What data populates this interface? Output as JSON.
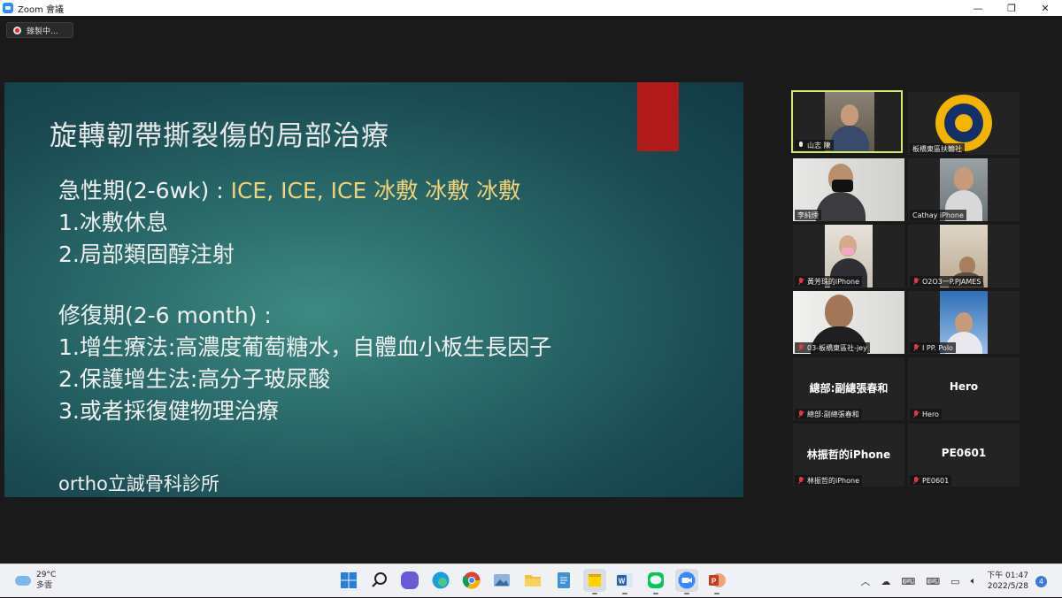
{
  "window": {
    "title": "Zoom 會議",
    "minimize": "—",
    "restore": "❐",
    "close": "✕"
  },
  "recording": {
    "label": "錄製中..."
  },
  "slide": {
    "title": "旋轉韌帶撕裂傷的局部治療",
    "acute_prefix": "急性期(2-6wk) : ",
    "acute_accent": "ICE, ICE, ICE 冰敷 冰敷 冰敷",
    "acute_items": [
      "1.冰敷休息",
      "2.局部類固醇注射"
    ],
    "repair_heading": "修復期(2-6 month) :",
    "repair_items": [
      "1.增生療法:高濃度葡萄糖水，自體血小板生長因子",
      "2.保護增生法:高分子玻尿酸",
      "3.或者採復健物理治療"
    ],
    "clinic": "ortho立誠骨科診所",
    "accent_color": "#f3d37a",
    "tab_color": "#b01a1a"
  },
  "participants": [
    {
      "name": "山志 陳",
      "muted": false,
      "active": true,
      "kind": "video"
    },
    {
      "name": "板橋東區扶輪社",
      "muted": false,
      "active": false,
      "kind": "logo"
    },
    {
      "name": "李純煙",
      "muted": false,
      "active": false,
      "kind": "video"
    },
    {
      "name": "Cathay iPhone",
      "muted": false,
      "active": false,
      "kind": "video"
    },
    {
      "name": "黃芳珠的iPhone",
      "muted": true,
      "active": false,
      "kind": "video"
    },
    {
      "name": "O2O3一P.PJAMES",
      "muted": true,
      "active": false,
      "kind": "video"
    },
    {
      "name": "03-板橋東區社-jey",
      "muted": true,
      "active": false,
      "kind": "video"
    },
    {
      "name": "I PP.  Polo",
      "muted": true,
      "active": false,
      "kind": "video"
    },
    {
      "name": "總部:副總張春和",
      "display": "總部:副總張春和",
      "muted": true,
      "active": false,
      "kind": "text"
    },
    {
      "name": "Hero",
      "display": "Hero",
      "muted": true,
      "active": false,
      "kind": "text"
    },
    {
      "name": "林振哲的iPhone",
      "display": "林振哲的iPhone",
      "muted": true,
      "active": false,
      "kind": "text"
    },
    {
      "name": "PE0601",
      "display": "PE0601",
      "muted": true,
      "active": false,
      "kind": "text"
    }
  ],
  "taskbar": {
    "weather": {
      "temp": "29°C",
      "condition": "多雲",
      "icon": "cloud-icon"
    },
    "apps": [
      {
        "name": "start-icon",
        "running": false
      },
      {
        "name": "search-icon",
        "running": false
      },
      {
        "name": "chat-icon",
        "running": false
      },
      {
        "name": "edge-icon",
        "running": false
      },
      {
        "name": "chrome-icon",
        "running": false
      },
      {
        "name": "photos-icon",
        "running": false
      },
      {
        "name": "file-explorer-icon",
        "running": false
      },
      {
        "name": "notepad-icon",
        "running": false
      },
      {
        "name": "sticky-notes-icon",
        "running": true
      },
      {
        "name": "word-icon",
        "running": true
      },
      {
        "name": "line-icon",
        "running": true
      },
      {
        "name": "zoom-icon",
        "running": true
      },
      {
        "name": "powerpoint-icon",
        "running": true
      }
    ],
    "clock": {
      "time": "下午 01:47",
      "date": "2022/5/28"
    },
    "notifications": "4"
  }
}
